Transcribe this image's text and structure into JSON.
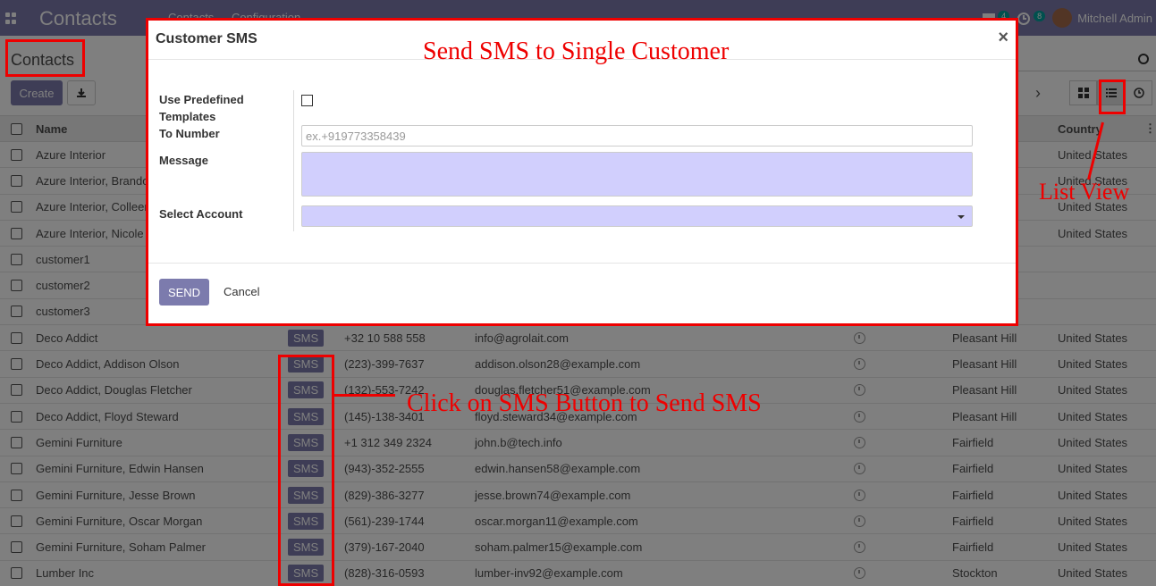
{
  "navbar": {
    "app_name": "Contacts",
    "menu": [
      "Contacts",
      "Configuration"
    ],
    "chat_count": "4",
    "activity_count": "8",
    "user": "Mitchell Admin"
  },
  "control_panel": {
    "breadcrumb": "Contacts",
    "create_label": "Create"
  },
  "table": {
    "headers": {
      "name": "Name",
      "country": "Country"
    },
    "rows": [
      {
        "name": "Azure Interior",
        "sms": "",
        "phone": "",
        "email": "",
        "city": "",
        "country": "United States"
      },
      {
        "name": "Azure Interior, Brandon Freeman",
        "sms": "",
        "phone": "",
        "email": "",
        "city": "",
        "country": "United States"
      },
      {
        "name": "Azure Interior, Colleen Diaz",
        "sms": "",
        "phone": "",
        "email": "",
        "city": "",
        "country": "United States"
      },
      {
        "name": "Azure Interior, Nicole Ford",
        "sms": "",
        "phone": "",
        "email": "",
        "city": "",
        "country": "United States"
      },
      {
        "name": "customer1",
        "sms": "",
        "phone": "",
        "email": "",
        "city": "",
        "country": ""
      },
      {
        "name": "customer2",
        "sms": "",
        "phone": "",
        "email": "",
        "city": "",
        "country": ""
      },
      {
        "name": "customer3",
        "sms": "",
        "phone": "",
        "email": "",
        "city": "",
        "country": ""
      },
      {
        "name": "Deco Addict",
        "sms": "SMS",
        "phone": "+32 10 588 558",
        "email": "info@agrolait.com",
        "city": "Pleasant Hill",
        "country": "United States"
      },
      {
        "name": "Deco Addict, Addison Olson",
        "sms": "SMS",
        "phone": "(223)-399-7637",
        "email": "addison.olson28@example.com",
        "city": "Pleasant Hill",
        "country": "United States"
      },
      {
        "name": "Deco Addict, Douglas Fletcher",
        "sms": "SMS",
        "phone": "(132)-553-7242",
        "email": "douglas.fletcher51@example.com",
        "city": "Pleasant Hill",
        "country": "United States"
      },
      {
        "name": "Deco Addict, Floyd Steward",
        "sms": "SMS",
        "phone": "(145)-138-3401",
        "email": "floyd.steward34@example.com",
        "city": "Pleasant Hill",
        "country": "United States"
      },
      {
        "name": "Gemini Furniture",
        "sms": "SMS",
        "phone": "+1 312 349 2324",
        "email": "john.b@tech.info",
        "city": "Fairfield",
        "country": "United States"
      },
      {
        "name": "Gemini Furniture, Edwin Hansen",
        "sms": "SMS",
        "phone": "(943)-352-2555",
        "email": "edwin.hansen58@example.com",
        "city": "Fairfield",
        "country": "United States"
      },
      {
        "name": "Gemini Furniture, Jesse Brown",
        "sms": "SMS",
        "phone": "(829)-386-3277",
        "email": "jesse.brown74@example.com",
        "city": "Fairfield",
        "country": "United States"
      },
      {
        "name": "Gemini Furniture, Oscar Morgan",
        "sms": "SMS",
        "phone": "(561)-239-1744",
        "email": "oscar.morgan11@example.com",
        "city": "Fairfield",
        "country": "United States"
      },
      {
        "name": "Gemini Furniture, Soham Palmer",
        "sms": "SMS",
        "phone": "(379)-167-2040",
        "email": "soham.palmer15@example.com",
        "city": "Fairfield",
        "country": "United States"
      },
      {
        "name": "Lumber Inc",
        "sms": "SMS",
        "phone": "(828)-316-0593",
        "email": "lumber-inv92@example.com",
        "city": "Stockton",
        "country": "United States"
      }
    ]
  },
  "modal": {
    "title": "Customer SMS",
    "label_templates": "Use Predefined Templates",
    "label_to_number": "To Number",
    "to_number_placeholder": "ex.+919773358439",
    "label_message": "Message",
    "label_account": "Select Account",
    "send_label": "SEND",
    "cancel_label": "Cancel"
  },
  "annotations": {
    "single_customer": "Send SMS to Single Customer",
    "click_sms": "Click on SMS Button to Send SMS",
    "list_view": "List View"
  },
  "colors": {
    "primary": "#7c7bad",
    "annotation": "#ee0000",
    "field_highlight": "#d1cffd"
  }
}
